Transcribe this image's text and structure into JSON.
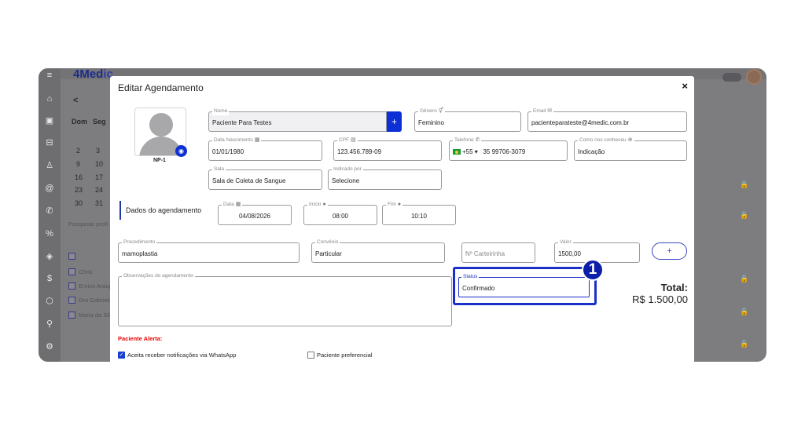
{
  "app": {
    "logo_prefix": "4Med",
    "logo_suffix": "ic"
  },
  "background": {
    "calendar": {
      "back": "<",
      "days": [
        "Dom",
        "Seg"
      ],
      "dates": [
        [
          "2",
          "3"
        ],
        [
          "9",
          "10"
        ],
        [
          "16",
          "17"
        ],
        [
          "23",
          "24"
        ],
        [
          "30",
          "31"
        ]
      ]
    },
    "search_placeholder": "Pesquisar profi",
    "professionals": [
      "Chris",
      "Enrico Araujo",
      "Dra Gabriela",
      "Maria da Silva"
    ],
    "professionals_checked": [
      false,
      false,
      true,
      false
    ]
  },
  "modal": {
    "title": "Editar Agendamento",
    "close": "×",
    "photo_id": "NP-1",
    "fields": {
      "nome": {
        "label": "Nome",
        "value": "Paciente Para Testes"
      },
      "genero": {
        "label": "Gênero",
        "value": "Feminino"
      },
      "email": {
        "label": "Email",
        "value": "pacienteparateste@4medic.com.br"
      },
      "nascimento": {
        "label": "Data Nascimento",
        "value": "01/01/1980"
      },
      "cpf": {
        "label": "CPF",
        "value": "123.456.789-09"
      },
      "telefone": {
        "label": "Telefone",
        "prefix": "+55 ▾",
        "value": "35 99706-3079"
      },
      "como": {
        "label": "Como nos conheceu",
        "value": "Indicação"
      },
      "sala": {
        "label": "Sala",
        "value": "Sala de Coleta de Sangue"
      },
      "indicado": {
        "label": "Indicado por",
        "value": "Selecione"
      },
      "data": {
        "label": "Data",
        "value": "04/08/2026"
      },
      "inicio": {
        "label": "Início",
        "value": "08:00"
      },
      "fim": {
        "label": "Fim",
        "value": "10:10"
      },
      "procedimento": {
        "label": "Procedimento",
        "value": "mamoplastia"
      },
      "convenio": {
        "label": "Convênio",
        "value": "Particular"
      },
      "carteirinha": {
        "placeholder": "Nº Carteirinha"
      },
      "valor": {
        "label": "Valor",
        "value": "1500,00"
      },
      "observacoes": {
        "label": "Observações do agendamento"
      },
      "status": {
        "label": "Status",
        "value": "Confirmado"
      }
    },
    "section_label": "Dados do agendamento",
    "add_label": "+",
    "total_label": "Total:",
    "total_value": "R$ 1.500,00",
    "alert_label": "Paciente Alerta:",
    "whatsapp_label": "Aceita receber notificações via WhatsApp",
    "whatsapp_checked": true,
    "preferencial_label": "Paciente preferencial",
    "preferencial_checked": false,
    "step_badge": "1"
  },
  "colors": {
    "accent": "#0d2fd6",
    "highlight": "#1a30c8",
    "alert": "#e00000"
  }
}
